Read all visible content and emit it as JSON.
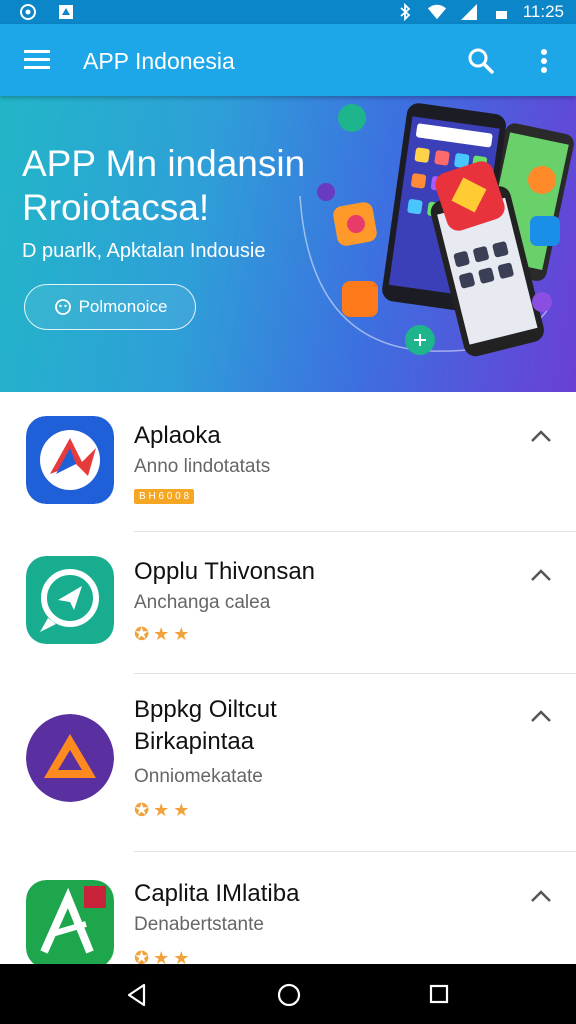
{
  "status_bar": {
    "time": "11:25"
  },
  "app_bar": {
    "title": "APP Indonesia"
  },
  "banner": {
    "title": "APP Mn indansin Rroiotacsa!",
    "subtitle": "D puarlk, Apktalan Indousie",
    "button_label": "Polmonoice"
  },
  "apps": [
    {
      "name": "Aplaoka",
      "category": "Anno lindotatats",
      "badge": "B H 6 0 0 8",
      "icon": "red-arrow-icon"
    },
    {
      "name": "Opplu Thivonsan",
      "category": "Anchanga calea",
      "rating_stars": 3,
      "icon": "chat-arrow-icon"
    },
    {
      "name": "Bppkg Oiltcut Birkapintaa",
      "category": "Onniomekatate",
      "rating_stars": 3,
      "icon": "triangle-icon"
    },
    {
      "name": "Caplita IMlatiba",
      "category": "Denabertstante",
      "rating_stars": 3,
      "icon": "letter-a-icon"
    }
  ],
  "colors": {
    "primary": "#1ea7e8",
    "status_bar": "#0b86c9",
    "star": "#f2a23a"
  }
}
